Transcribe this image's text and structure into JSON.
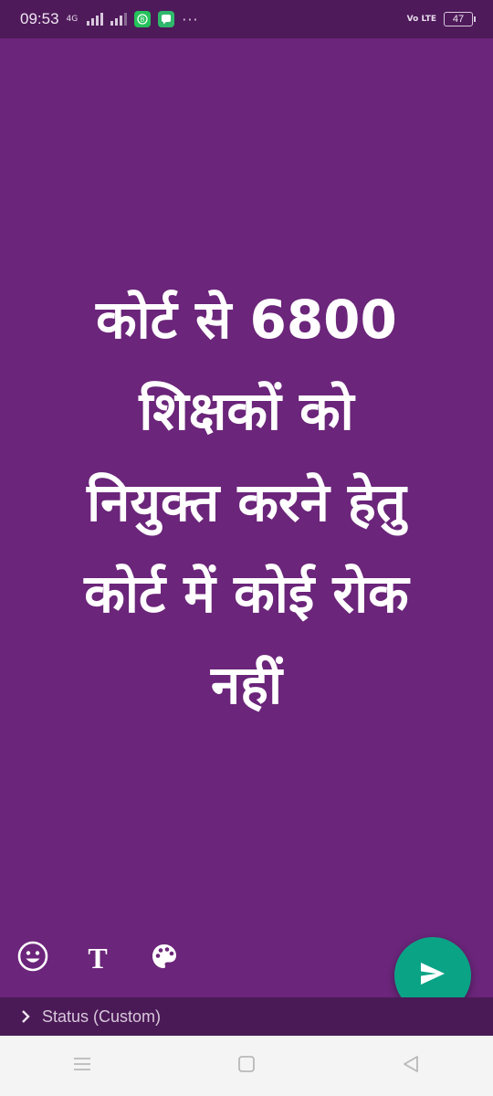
{
  "status_bar": {
    "time": "09:53",
    "network": "4G",
    "volte": "Vo LTE",
    "battery": "47",
    "more": "···"
  },
  "status": {
    "text_line1": "कोर्ट से 6800",
    "text_line2": "शिक्षकों को",
    "text_line3": "नियुक्त करने हेतु",
    "text_line4": "कोर्ट में कोई रोक",
    "text_line5": "नहीं",
    "background_color": "#6b257a"
  },
  "tools": {
    "emoji_icon": "emoji-icon",
    "text_icon": "text-style-icon",
    "text_glyph": "T",
    "palette_icon": "palette-icon"
  },
  "audience": {
    "label": "Status (Custom)"
  },
  "colors": {
    "send_button": "#0ba386",
    "status_bar": "#4e1a5a"
  }
}
